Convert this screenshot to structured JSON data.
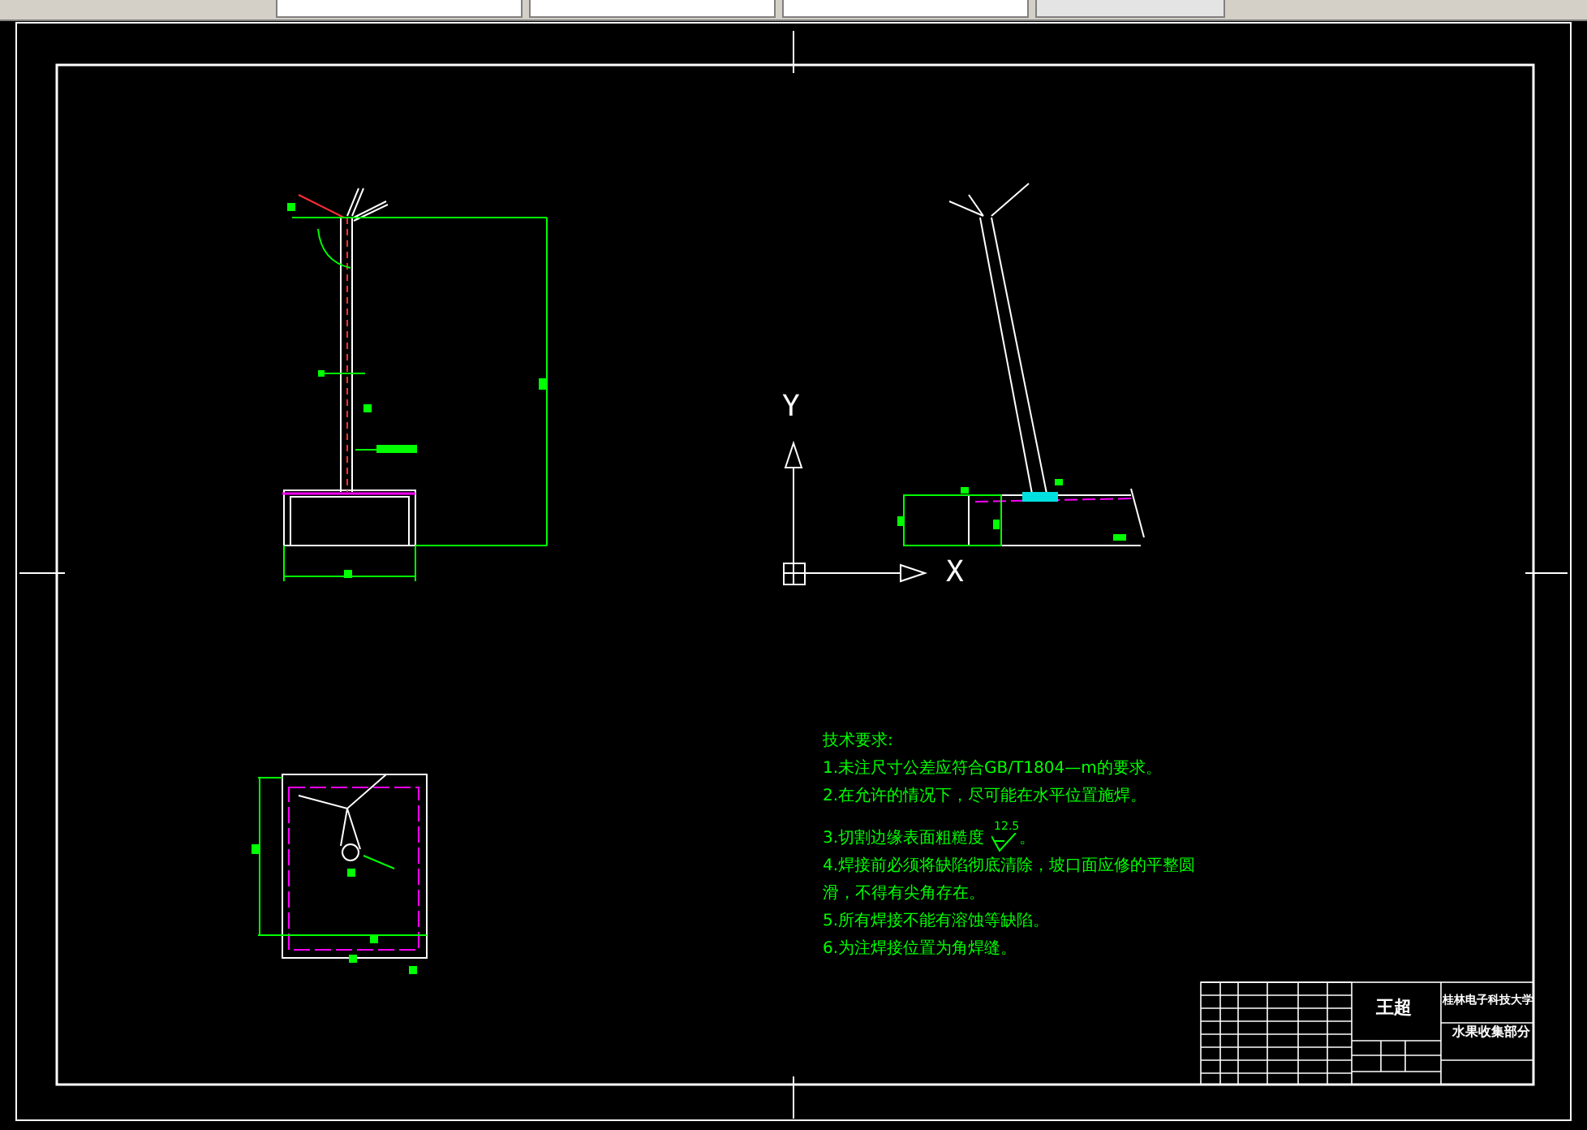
{
  "axes": {
    "y_label": "Y",
    "x_label": "X"
  },
  "notes": {
    "title": "技术要求:",
    "items": [
      {
        "kind": "text",
        "text": "1.未注尺寸公差应符合GB/T1804—m的要求。"
      },
      {
        "kind": "text",
        "text": "2.在允许的情况下，尽可能在水平位置施焊。"
      },
      {
        "kind": "roughness",
        "text": "3.切割边缘表面粗糙度",
        "value": "12.5",
        "suffix": "。"
      },
      {
        "kind": "text",
        "text": "4.焊接前必须将缺陷彻底清除，坡口面应修的平整圆滑，不得有尖角存在。"
      },
      {
        "kind": "text",
        "text": "5.所有焊接不能有溶蚀等缺陷。"
      },
      {
        "kind": "text",
        "text": "6.为注焊接位置为角焊缝。"
      }
    ]
  },
  "title_block": {
    "designer": "王超",
    "school": "桂林电子科技大学",
    "part_name": "水果收集部分"
  }
}
